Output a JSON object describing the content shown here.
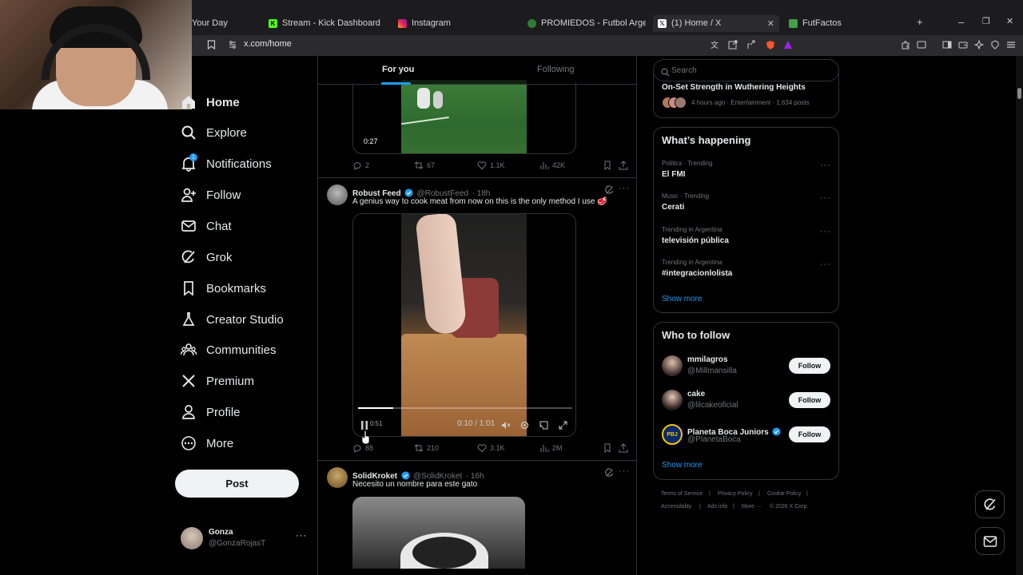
{
  "browser": {
    "tabs": [
      {
        "label": "Your Day",
        "icon": "generic-tab-icon"
      },
      {
        "label": "Stream - Kick Dashboard",
        "icon": "kick-icon"
      },
      {
        "label": "Instagram",
        "icon": "instagram-icon"
      },
      {
        "label": "PROMIEDOS - Futbol Argentino - Fú",
        "icon": "promiedos-icon"
      },
      {
        "label": "(1) Home / X",
        "icon": "x-icon"
      },
      {
        "label": "FutFactos",
        "icon": "futfactos-icon"
      }
    ],
    "new_tab": "+",
    "url": "x.com/home",
    "window_controls": [
      "–",
      "❐",
      "✕"
    ]
  },
  "nav": {
    "items": [
      {
        "label": "Home",
        "icon": "home-icon"
      },
      {
        "label": "Explore",
        "icon": "search-icon"
      },
      {
        "label": "Notifications",
        "icon": "bell-icon",
        "badge": "1"
      },
      {
        "label": "Follow",
        "icon": "person-add-icon"
      },
      {
        "label": "Chat",
        "icon": "mail-icon"
      },
      {
        "label": "Grok",
        "icon": "grok-icon"
      },
      {
        "label": "Bookmarks",
        "icon": "bookmark-icon"
      },
      {
        "label": "Creator Studio",
        "icon": "flask-icon"
      },
      {
        "label": "Communities",
        "icon": "communities-icon"
      },
      {
        "label": "Premium",
        "icon": "x-logo-icon"
      },
      {
        "label": "Profile",
        "icon": "profile-icon"
      },
      {
        "label": "More",
        "icon": "more-circle-icon"
      }
    ],
    "post_label": "Post",
    "account": {
      "name": "Gonza",
      "handle": "@GonzaRojasT",
      "menu": "···"
    }
  },
  "feed": {
    "tabs": [
      "For you",
      "Following"
    ],
    "tweet1": {
      "video_time": "0:27",
      "replies": "2",
      "reposts": "67",
      "likes": "1.1K",
      "views": "42K"
    },
    "tweet2": {
      "author": "Robust Feed",
      "handle": "@RobustFeed",
      "time": "· 18h",
      "text": "A genius way to cook meat from now on this is the only method I use 🥩",
      "video_progress": "0:10 / 1:01",
      "video_cut": "0:51",
      "replies": "88",
      "reposts": "210",
      "likes": "3.1K",
      "views": "2M"
    },
    "tweet3": {
      "author": "SolidKroket",
      "handle": "@SolidKroket",
      "time": "· 16h",
      "text": "Necesito un nombre para este gato"
    }
  },
  "search": {
    "placeholder": "Search"
  },
  "news_top": {
    "title": "On-Set Strength in Wuthering Heights",
    "meta": "4 hours ago · Entertainment · 1,634 posts"
  },
  "whats_happening": {
    "title": "What’s happening",
    "trends": [
      {
        "meta": "Politics · Trending",
        "name": "El FMI"
      },
      {
        "meta": "Music · Trending",
        "name": "Cerati"
      },
      {
        "meta": "Trending in Argentina",
        "name": "televisión pública"
      },
      {
        "meta": "Trending in Argentina",
        "name": "#integracionlolista"
      }
    ],
    "more_menu": "···",
    "show_more": "Show more"
  },
  "who_to_follow": {
    "title": "Who to follow",
    "users": [
      {
        "name": "mmilagros",
        "handle": "@Millmansilla",
        "button": "Follow"
      },
      {
        "name": "cake",
        "handle": "@lilcakeoficial",
        "button": "Follow"
      },
      {
        "name": "Planeta Boca Juniors",
        "handle": "@PlanetaBoca",
        "button": "Follow",
        "avatar_text": "PBJ"
      }
    ],
    "show_more": "Show more"
  },
  "footer": {
    "links": [
      "Terms of Service",
      "Privacy Policy",
      "Cookie Policy",
      "Accessibility",
      "Ads info",
      "More ···",
      "© 2026 X Corp."
    ]
  },
  "colors": {
    "accent": "#1d9bf0",
    "bg": "#000000",
    "text": "#e7e9ea",
    "muted": "#71767b",
    "border": "#2f3336"
  }
}
